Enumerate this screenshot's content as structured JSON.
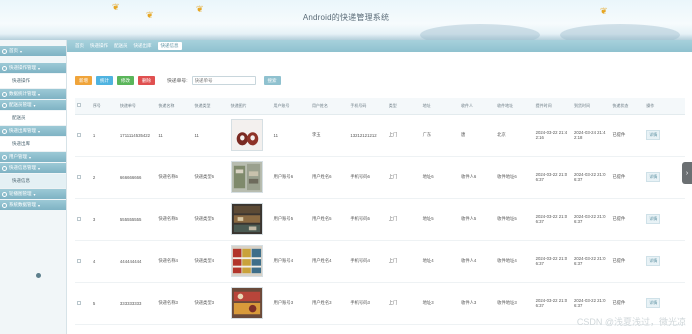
{
  "header": {
    "title": "Android的快递管理系统"
  },
  "sidebar": {
    "items": [
      {
        "label": "首页",
        "type": "group"
      },
      {
        "label": "快递操作管理",
        "type": "group"
      },
      {
        "label": "快递操作",
        "type": "sub"
      },
      {
        "label": "数据统计管理",
        "type": "group"
      },
      {
        "label": "配送员管理",
        "type": "group"
      },
      {
        "label": "配送员",
        "type": "sub"
      },
      {
        "label": "快递出库管理",
        "type": "group"
      },
      {
        "label": "快递出库",
        "type": "sub"
      },
      {
        "label": "用户管理",
        "type": "group"
      },
      {
        "label": "快递信息管理",
        "type": "group"
      },
      {
        "label": "快递信息",
        "type": "sub",
        "active": true
      },
      {
        "label": "轮播图管理",
        "type": "group"
      },
      {
        "label": "系统数据管理",
        "type": "group"
      }
    ]
  },
  "breadcrumb": [
    "首页",
    "快递操作",
    "配送员",
    "快递出库",
    "快递信息"
  ],
  "toolbar": {
    "add": "新增",
    "stats": "统计",
    "edit": "修改",
    "delete": "删除",
    "search_label": "快递单号:",
    "search_placeholder": "快递单号",
    "search_button": "搜索"
  },
  "table": {
    "headers": [
      "",
      "序号",
      "快递单号",
      "快递名称",
      "快递类型",
      "快递图片",
      "用户账号",
      "用户姓名",
      "手机号码",
      "类型",
      "地址",
      "收件人",
      "收件地址",
      "提件时间",
      "到货时间",
      "快递状态",
      "操作"
    ],
    "rows": [
      {
        "no": "1",
        "num": "1711114535422",
        "name": "11",
        "type": "11",
        "user": "11",
        "uname": "李玉",
        "phone": "13212121212",
        "kind": "上门",
        "addr": "广东",
        "recv": "唐",
        "raddr": "北京",
        "t1": "2024-03-22 21:42:16",
        "t2": "2024-03-24 21:42:18",
        "status": "已提件",
        "op": "详情"
      },
      {
        "no": "2",
        "num": "666666666",
        "name": "快递名称6",
        "type": "快递类型6",
        "user": "用户账号6",
        "uname": "用户姓名6",
        "phone": "手机号码6",
        "kind": "上门",
        "addr": "地址6",
        "recv": "收件人6",
        "raddr": "收件地址6",
        "t1": "2024-03-22 21:06:37",
        "t2": "2024-03-22 21:06:37",
        "status": "已提件",
        "op": "详情"
      },
      {
        "no": "3",
        "num": "555555555",
        "name": "快递名称5",
        "type": "快递类型5",
        "user": "用户账号5",
        "uname": "用户姓名5",
        "phone": "手机号码5",
        "kind": "上门",
        "addr": "地址5",
        "recv": "收件人5",
        "raddr": "收件地址5",
        "t1": "2024-03-22 21:06:37",
        "t2": "2024-03-22 21:06:37",
        "status": "已提件",
        "op": "详情"
      },
      {
        "no": "4",
        "num": "444444444",
        "name": "快递名称4",
        "type": "快递类型4",
        "user": "用户账号4",
        "uname": "用户姓名4",
        "phone": "手机号码4",
        "kind": "上门",
        "addr": "地址4",
        "recv": "收件人4",
        "raddr": "收件地址4",
        "t1": "2024-03-22 21:06:37",
        "t2": "2024-03-22 21:06:37",
        "status": "已提件",
        "op": "详情"
      },
      {
        "no": "5",
        "num": "333333333",
        "name": "快递名称3",
        "type": "快递类型3",
        "user": "用户账号3",
        "uname": "用户姓名3",
        "phone": "手机号码3",
        "kind": "上门",
        "addr": "地址3",
        "recv": "收件人3",
        "raddr": "收件地址3",
        "t1": "2024-03-22 21:06:37",
        "t2": "2024-03-22 21:06:37",
        "status": "已提件",
        "op": "详情"
      }
    ]
  },
  "watermark": "CSDN @浅夏浅过，微光凉",
  "colors": {
    "accent": "#8fc1cf",
    "add": "#f0a43a",
    "stats": "#4fb3e0",
    "edit": "#5ab55a",
    "delete": "#e05050"
  }
}
